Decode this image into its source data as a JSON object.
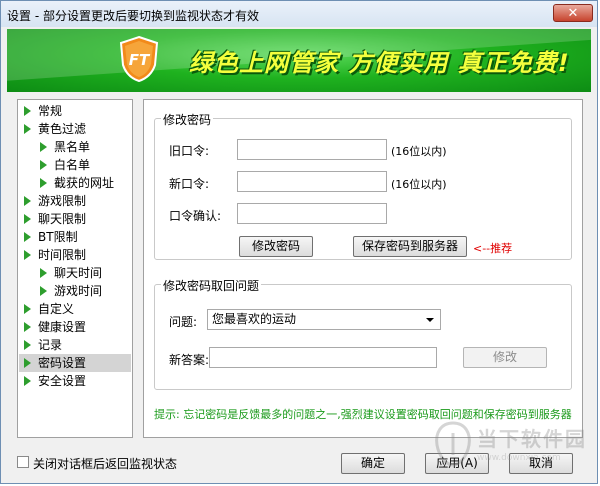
{
  "window": {
    "title": "设置 - 部分设置更改后要切换到监视状态才有效",
    "close_glyph": "✕"
  },
  "banner": {
    "logo_text": "FT",
    "slogan": "绿色上网管家  方便实用  真正免费!"
  },
  "nav": {
    "items": [
      {
        "label": "常规"
      },
      {
        "label": "黄色过滤"
      },
      {
        "label": "黑名单"
      },
      {
        "label": "白名单"
      },
      {
        "label": "截获的网址"
      },
      {
        "label": "游戏限制"
      },
      {
        "label": "聊天限制"
      },
      {
        "label": "BT限制"
      },
      {
        "label": "时间限制"
      },
      {
        "label": "聊天时间"
      },
      {
        "label": "游戏时间"
      },
      {
        "label": "自定义"
      },
      {
        "label": "健康设置"
      },
      {
        "label": "记录"
      },
      {
        "label": "密码设置",
        "selected": true
      },
      {
        "label": "安全设置"
      }
    ]
  },
  "password_group": {
    "legend": "修改密码",
    "old_label": "旧口令:",
    "old_value": "",
    "old_hint": "(16位以内)",
    "new_label": "新口令:",
    "new_value": "",
    "new_hint": "(16位以内)",
    "confirm_label": "口令确认:",
    "confirm_value": "",
    "change_button": "修改密码",
    "save_server_button": "保存密码到服务器",
    "recommend": "<--推荐"
  },
  "question_group": {
    "legend": "修改密码取回问题",
    "question_label": "问题:",
    "question_value": "您最喜欢的运动",
    "answer_label": "新答案:",
    "answer_value": "",
    "modify_button": "修改"
  },
  "tip": "提示: 忘记密码是反馈最多的问题之一,强烈建议设置密码取回问题和保存密码到服务器",
  "footer": {
    "checkbox_label": "关闭对话框后返回监视状态",
    "checkbox_checked": false,
    "ok_button": "确定",
    "apply_button": "应用(A)",
    "cancel_button": "取消"
  },
  "watermark": {
    "text": "当下软件园",
    "sub": "www.downxia.com"
  },
  "colors": {
    "banner_green": "#1fb21f",
    "slogan_yellow": "#f4ff3d",
    "nav_arrow": "#2e9e2e",
    "tip_green": "#1a9a1a",
    "recommend_red": "#e00000"
  }
}
